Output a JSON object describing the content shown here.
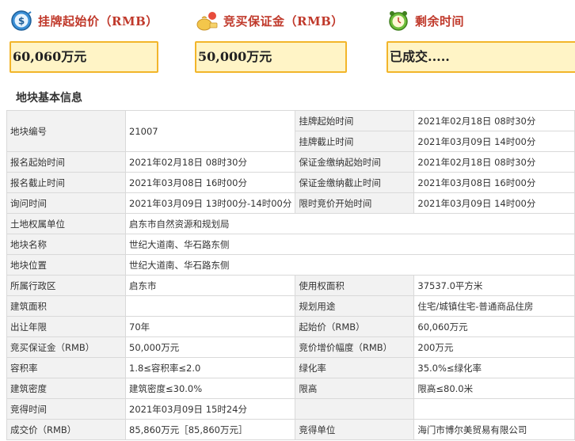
{
  "cards": {
    "start_price": {
      "title": "挂牌起始价（RMB）",
      "value": "60,060万元",
      "icon": "dollar-clock-icon"
    },
    "deposit": {
      "title": "竞买保证金（RMB）",
      "value": "50,000万元",
      "icon": "money-bag-icon"
    },
    "remaining": {
      "title": "剩余时间",
      "value": "已成交.....",
      "icon": "alarm-clock-icon"
    }
  },
  "colors": {
    "title_red": "#c0392b",
    "card_fill": "#fff4c6",
    "card_border": "#f2b52a"
  },
  "section": {
    "title": "地块基本信息"
  },
  "rows": {
    "r1": {
      "l1": "地块编号",
      "v1": "21007",
      "l2a": "挂牌起始时间",
      "v2a": "2021年02月18日 08时30分",
      "l2b": "挂牌截止时间",
      "v2b": "2021年03月09日 14时00分"
    },
    "r2": {
      "l1": "报名起始时间",
      "v1": "2021年02月18日 08时30分",
      "l2": "保证金缴纳起始时间",
      "v2": "2021年02月18日 08时30分"
    },
    "r3": {
      "l1": "报名截止时间",
      "v1": "2021年03月08日 16时00分",
      "l2": "保证金缴纳截止时间",
      "v2": "2021年03月08日 16时00分"
    },
    "r4": {
      "l1": "询问时间",
      "v1": "2021年03月09日 13时00分-14时00分",
      "l2": "限时竞价开始时间",
      "v2": "2021年03月09日 14时00分"
    },
    "r5": {
      "l1": "土地权属单位",
      "v1": "启东市自然资源和规划局"
    },
    "r6": {
      "l1": "地块名称",
      "v1": "世纪大道南、华石路东侧"
    },
    "r7": {
      "l1": "地块位置",
      "v1": "世纪大道南、华石路东侧"
    },
    "r8": {
      "l1": "所属行政区",
      "v1": "启东市",
      "l2": "使用权面积",
      "v2": "37537.0平方米"
    },
    "r9": {
      "l1": "建筑面积",
      "v1": "",
      "l2": "规划用途",
      "v2": "住宅/城镇住宅-普通商品住房"
    },
    "r10": {
      "l1": "出让年限",
      "v1": "70年",
      "l2": "起始价（RMB）",
      "v2": "60,060万元"
    },
    "r11": {
      "l1": "竞买保证金（RMB）",
      "v1": "50,000万元",
      "l2": "竞价增价幅度（RMB）",
      "v2": "200万元"
    },
    "r12": {
      "l1": "容积率",
      "v1": "1.8≤容积率≤2.0",
      "l2": "绿化率",
      "v2": "35.0%≤绿化率"
    },
    "r13": {
      "l1": "建筑密度",
      "v1": "建筑密度≤30.0%",
      "l2": "限高",
      "v2": "限高≤80.0米"
    },
    "r14": {
      "l1": "竞得时间",
      "v1": "2021年03月09日 15时24分",
      "l2": "",
      "v2": ""
    },
    "r15": {
      "l1": "成交价（RMB）",
      "v1": "85,860万元［85,860万元］",
      "l2": "竞得单位",
      "v2": "海门市博尔美贸易有限公司"
    }
  }
}
